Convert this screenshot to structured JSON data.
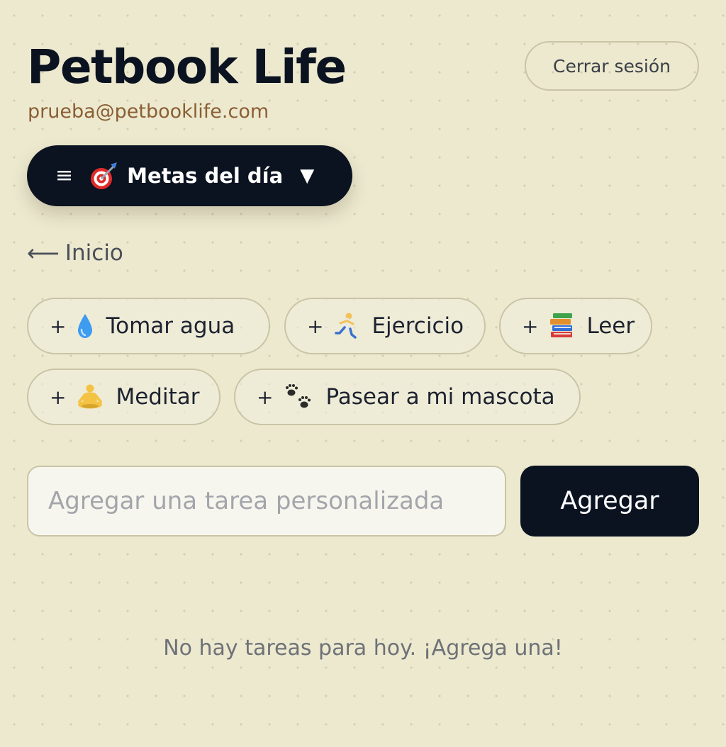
{
  "header": {
    "app_title": "Petbook Life",
    "user_email": "prueba@petbooklife.com",
    "logout_label": "Cerrar sesión"
  },
  "menu": {
    "hamburger": "≡",
    "label": "Metas del día",
    "caret": "▼",
    "icon": "dart-target-icon"
  },
  "nav": {
    "back_arrow": "⟵",
    "back_label": "Inicio"
  },
  "quick_tasks": [
    {
      "plus": "+",
      "label": "Tomar agua",
      "icon": "water-drop-icon"
    },
    {
      "plus": "+",
      "label": "Ejercicio",
      "icon": "runner-icon"
    },
    {
      "plus": "+",
      "label": "Leer",
      "icon": "books-icon"
    },
    {
      "plus": "+",
      "label": "Meditar",
      "icon": "meditation-icon"
    },
    {
      "plus": "+",
      "label": "Pasear a mi mascota",
      "icon": "paw-prints-icon"
    }
  ],
  "custom_task": {
    "placeholder": "Agregar una tarea personalizada",
    "value": "",
    "add_label": "Agregar"
  },
  "tasks": {
    "empty_message": "No hay tareas para hoy. ¡Agrega una!"
  },
  "colors": {
    "background": "#ece9cf",
    "primary": "#0b1220",
    "email": "#8b5e34",
    "border": "#c9c4a6"
  }
}
